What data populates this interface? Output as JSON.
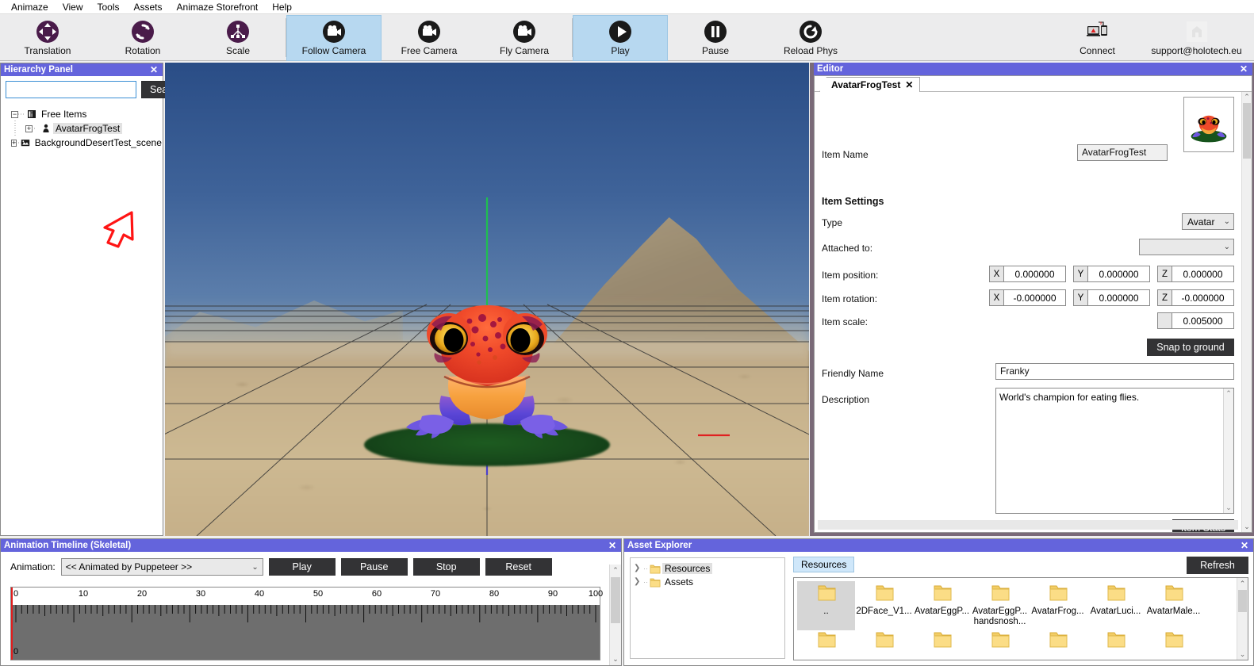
{
  "menu": {
    "items": [
      "Animaze",
      "View",
      "Tools",
      "Assets",
      "Animaze Storefront",
      "Help"
    ]
  },
  "toolbar": {
    "buttons": [
      {
        "label": "Translation",
        "icon": "move-icon",
        "active": false
      },
      {
        "label": "Rotation",
        "icon": "rotate-icon",
        "active": false
      },
      {
        "label": "Scale",
        "icon": "scale-icon",
        "active": false
      },
      {
        "label": "Follow Camera",
        "icon": "camera-icon",
        "active": true
      },
      {
        "label": "Free Camera",
        "icon": "camera-icon",
        "active": false
      },
      {
        "label": "Fly Camera",
        "icon": "camera-icon",
        "active": false
      },
      {
        "label": "Play",
        "icon": "play-icon",
        "active": true
      },
      {
        "label": "Pause",
        "icon": "pause-icon",
        "active": false
      },
      {
        "label": "Reload Phys",
        "icon": "reload-icon",
        "active": false
      }
    ],
    "connect_label": "Connect",
    "connect_icon": "connect-devices-icon",
    "account_label": "support@holotech.eu",
    "account_icon": "holotech-logo-icon"
  },
  "hierarchy": {
    "title": "Hierarchy Panel",
    "close_icon": "close-icon",
    "search_value": "",
    "search_placeholder": "",
    "search_button": "Search",
    "tree": [
      {
        "label": "Free Items",
        "expander": "-",
        "icon": "folder-items-icon",
        "depth": 0,
        "selected": false
      },
      {
        "label": "AvatarFrogTest",
        "expander": "+",
        "icon": "avatar-icon",
        "depth": 1,
        "selected": true
      },
      {
        "label": "BackgroundDesertTest_scene",
        "expander": "+",
        "icon": "scene-icon",
        "depth": 0,
        "selected": false
      }
    ],
    "annotation_icon": "red-arrow-annotation"
  },
  "viewport": {
    "name": "3d-viewport",
    "gizmo_axis_up_color": "#1fbf4f",
    "gizmo_axis_down_color": "#4a3fcf",
    "gizmo_axis_right_color": "#e02020",
    "grid_color": "#3a3a3a"
  },
  "editor": {
    "title": "Editor",
    "close_icon": "close-icon",
    "tab": {
      "label": "AvatarFrogTest",
      "close_icon": "close-icon"
    },
    "item_name_label": "Item Name",
    "item_name_value": "AvatarFrogTest",
    "thumbnail_name": "avatar-thumbnail",
    "section_title": "Item Settings",
    "type_label": "Type",
    "type_value": "Avatar",
    "attached_label": "Attached to:",
    "attached_value": "",
    "position_label": "Item position:",
    "position": [
      {
        "axis": "X",
        "value": "0.000000"
      },
      {
        "axis": "Y",
        "value": "0.000000"
      },
      {
        "axis": "Z",
        "value": "0.000000"
      }
    ],
    "rotation_label": "Item rotation:",
    "rotation": [
      {
        "axis": "X",
        "value": "-0.000000"
      },
      {
        "axis": "Y",
        "value": "0.000000"
      },
      {
        "axis": "Z",
        "value": "-0.000000"
      }
    ],
    "scale_label": "Item scale:",
    "scale_value": "0.005000",
    "snap_button": "Snap to ground",
    "friendly_name_label": "Friendly Name",
    "friendly_name_value": "Franky",
    "description_label": "Description",
    "description_value": "World's champion for eating flies.",
    "item_stats_button": "Item Stats"
  },
  "timeline": {
    "title": "Animation Timeline (Skeletal)",
    "close_icon": "close-icon",
    "animation_label": "Animation:",
    "animation_value": "<< Animated by Puppeteer >>",
    "buttons": [
      "Play",
      "Pause",
      "Stop",
      "Reset"
    ],
    "ruler_ticks": [
      "0",
      "10",
      "20",
      "30",
      "40",
      "50",
      "60",
      "70",
      "80",
      "90",
      "100"
    ],
    "track_label": "0",
    "playhead_position": "0"
  },
  "asset_explorer": {
    "title": "Asset Explorer",
    "close_icon": "close-icon",
    "tree": [
      {
        "label": "Resources",
        "icon": "folder-icon",
        "selected": true
      },
      {
        "label": "Assets",
        "icon": "folder-icon",
        "selected": false
      }
    ],
    "breadcrumb": "Resources",
    "refresh_button": "Refresh",
    "files": [
      {
        "name": "..",
        "icon": "folder-icon",
        "selected": true
      },
      {
        "name": "2DFace_V1...",
        "icon": "folder-icon",
        "selected": false
      },
      {
        "name": "AvatarEggP...",
        "icon": "folder-icon",
        "selected": false
      },
      {
        "name": "AvatarEggP... handsnosh...",
        "icon": "folder-icon",
        "selected": false
      },
      {
        "name": "AvatarFrog...",
        "icon": "folder-icon",
        "selected": false
      },
      {
        "name": "AvatarLuci...",
        "icon": "folder-icon",
        "selected": false
      },
      {
        "name": "AvatarMale...",
        "icon": "folder-icon",
        "selected": false
      }
    ]
  }
}
